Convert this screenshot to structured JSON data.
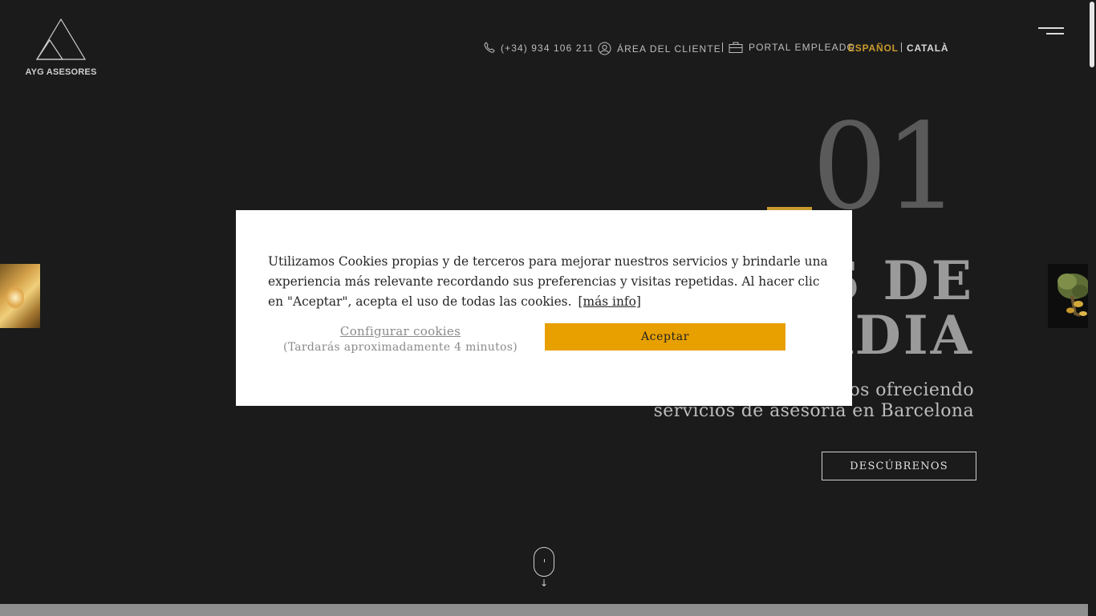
{
  "brand": {
    "logo_text": "AYG ASESORES"
  },
  "header": {
    "phone": "(+34) 934 106 211",
    "client_area": "ÁREA DEL CLIENTE",
    "employee_portal": "PORTAL EMPLEADO",
    "lang_es": "ESPAÑOL",
    "lang_ca": "CATALÀ"
  },
  "hero": {
    "number": "01",
    "title_line1": "S DE",
    "title_line2": "RDIA",
    "subtitle_line1": "os ofreciendo",
    "subtitle_line2": "servicios de asesoría en Barcelona",
    "cta": "DESCÚBRENOS"
  },
  "cookie": {
    "text": "Utilizamos Cookies propias y de terceros para mejorar nuestros servicios y brindarle una experiencia más relevante recordando sus preferencias y visitas repetidas. Al hacer clic en \"Aceptar\", acepta el uso de todas las cookies.",
    "more_info": "[más info]",
    "configure": "Configurar cookies",
    "configure_note": "(Tardarás aproximadamente 4 minutos)",
    "accept": "Aceptar"
  },
  "colors": {
    "background": "#1b1b1b",
    "gold": "#c99a2e",
    "accept_button": "#e8a000"
  },
  "icons": [
    "phone-icon",
    "user-circle-icon",
    "briefcase-icon",
    "hamburger-menu-icon",
    "scroll-mouse-icon",
    "arrow-down-icon"
  ]
}
